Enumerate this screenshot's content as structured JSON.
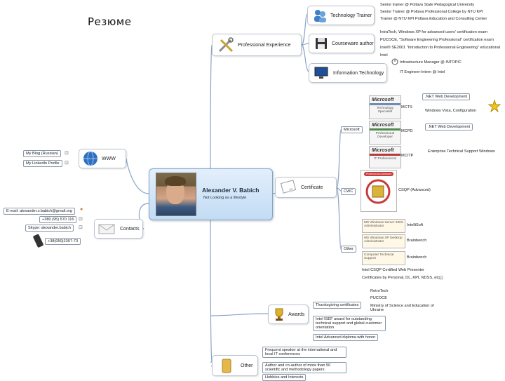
{
  "page_title": "Резюме",
  "central": {
    "name": "Alexander V. Babich",
    "subtitle": "Not Looking as a lifestyle"
  },
  "experience": {
    "label": "Professional Experience",
    "technology_trainer": {
      "label": "Technology Trainer",
      "items": [
        "Senior trainer @ Poltava State Pedagogical University",
        "Senior Trainer @ Poltava Professional College by NTU KPI",
        "Trainer @ NTU KPI Poltava Education and Consulting Center"
      ]
    },
    "courseware_author": {
      "label": "Courseware author",
      "items": [
        "IntraTech, Windows XP for advanced users' certification exam",
        "PUCOCE, \"Software Engineering Professional\" certification exam",
        "Intel® SE2001 \"Introduction to Professional Engineering\" educational",
        "Intel"
      ]
    },
    "information_technology": {
      "label": "Information Technology",
      "items": [
        "Infrastructure Manager @ INTOPIC",
        "IT Engineer-Intern @ Intel"
      ]
    }
  },
  "www": {
    "label": "WWW",
    "links": [
      "My Blog (Russian)",
      "My LinkedIn Profile"
    ]
  },
  "contacts": {
    "label": "Contacts",
    "items": [
      "E-mail: alexander.v.babich@gmail.org",
      "+380 (95) 570 116",
      "Skype: alexander.babich",
      "+38(050)2307-73"
    ]
  },
  "certificate": {
    "label": "Certificate",
    "microsoft": {
      "label": "Microsoft",
      "certs": [
        {
          "badge": "MCTS",
          "note": ".NET Web Development",
          "extra": "Windows Vista, Configuration",
          "caption": "Technology Specialist"
        },
        {
          "badge": "MCPD",
          "note": ".NET Web Development",
          "caption": "Professional Developer"
        },
        {
          "badge": "MCITP",
          "note": "Enterprise Technical Support Windows",
          "caption": "IT Professional"
        }
      ]
    },
    "cwc": {
      "label": "CWC",
      "item": "CSQP (Advanced)",
      "badge": "Professional Advanced"
    },
    "other": {
      "label": "Other",
      "certs": [
        {
          "note": "IntelliSoft",
          "caption": "MS Windows Server 2003 Administrator"
        },
        {
          "note": "Brainbench",
          "caption": "MS Windows XP Desktop Administrator"
        },
        {
          "note": "Brainbench",
          "caption": "Computer Technical Support"
        }
      ],
      "extras": [
        "Intel CSQP Certified Web Presenter",
        "Certificates by Personal, DL, KPI, NDSS, etc."
      ]
    }
  },
  "awards": {
    "label": "Awards",
    "items": [
      "Thanksgiving certificates",
      "Intel ISEF award for outstanding technical support and global customer orientation",
      "Intel Advanced diploma with honor"
    ],
    "orgs": [
      "RetroTech",
      "PUCOCE",
      "Ministry of Science and Education of Ukraine"
    ]
  },
  "other": {
    "label": "Other",
    "items": [
      "Frequent speaker at the international and local IT conferences",
      "Author and co-author of more than 50 scientific and methodology papers",
      "Hobbies and Interests"
    ]
  },
  "colors": {
    "edge": "#8aa4c8",
    "central_top": "#e3effb",
    "central_bottom": "#c2dbf4",
    "ms_blue": "#6e8cb5"
  }
}
